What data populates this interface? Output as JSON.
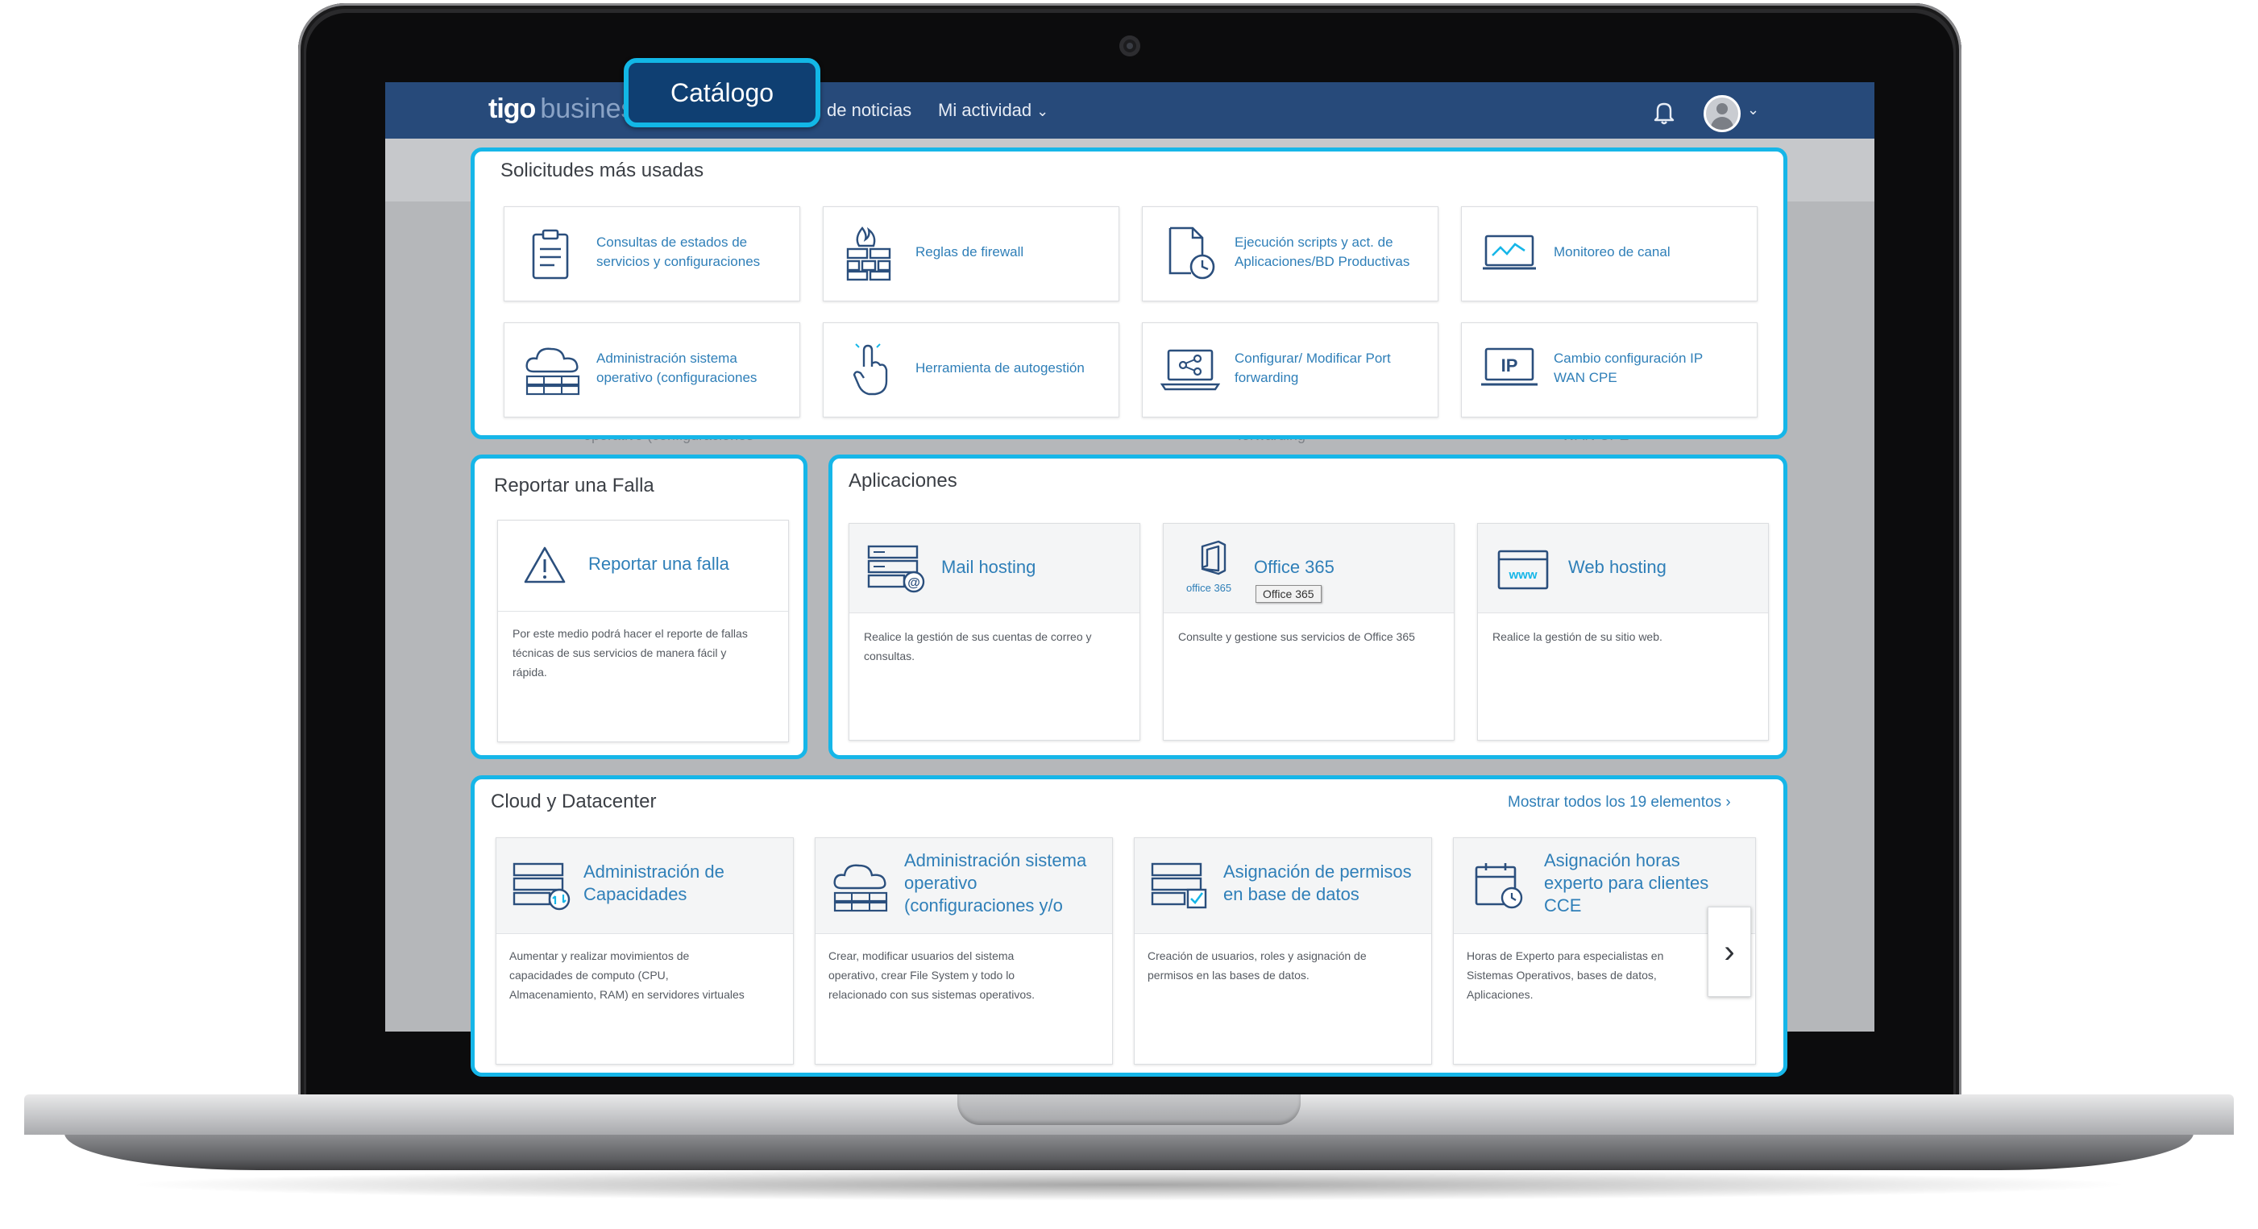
{
  "header": {
    "logo": "tigo",
    "logo_sub": "business",
    "nav": [
      "de noticias",
      "Mi actividad"
    ],
    "chevron": "⌄"
  },
  "callout": {
    "label": "Catálogo"
  },
  "most_used": {
    "title": "Solicitudes más usadas",
    "items": [
      {
        "label": "Consultas de estados de\nservicios y configuraciones",
        "icon": "clipboard-icon"
      },
      {
        "label": "Reglas de firewall",
        "icon": "firewall-icon"
      },
      {
        "label": "Ejecución scripts y act. de\nAplicaciones/BD Productivas",
        "icon": "document-clock-icon"
      },
      {
        "label": "Monitoreo de canal",
        "icon": "monitor-chart-icon"
      },
      {
        "label": "Administración sistema\noperativo (configuraciones",
        "icon": "cloud-servers-icon"
      },
      {
        "label": "Herramienta de autogestión",
        "icon": "hand-pointer-icon"
      },
      {
        "label": "Configurar/ Modificar Port\nforwarding",
        "icon": "laptop-share-icon"
      },
      {
        "label": "Cambio configuración IP\nWAN CPE",
        "icon": "ip-monitor-icon"
      }
    ]
  },
  "ghost_row": [
    "operativo (configuraciones",
    "forwarding",
    "WAN CPE"
  ],
  "report": {
    "title": "Reportar una Falla",
    "card_title": "Reportar una falla",
    "desc": "Por este medio podrá hacer el reporte de fallas\ntécnicas de sus servicios de manera fácil y\nrápida."
  },
  "apps": {
    "title": "Aplicaciones",
    "items": [
      {
        "title": "Mail hosting",
        "desc": "Realice la gestión de sus cuentas de correo y\nconsultas.",
        "icon": "mail-server-icon"
      },
      {
        "title": "Office 365",
        "desc": "Consulte y gestione sus servicios de Office 365",
        "icon": "office365-icon",
        "logo_text": "office 365",
        "tooltip": "Office 365"
      },
      {
        "title": "Web hosting",
        "desc": "Realice la gestión de su sitio web.",
        "icon": "www-icon"
      }
    ]
  },
  "cloud": {
    "title": "Cloud y Datacenter",
    "show_all": "Mostrar todos los 19 elementos ›",
    "items": [
      {
        "title": "Administración de\nCapacidades",
        "desc": "Aumentar y realizar movimientos de\ncapacidades de computo (CPU,\nAlmacenamiento, RAM) en servidores virtuales",
        "icon": "server-sync-icon"
      },
      {
        "title": "Administración sistema\noperativo\n(configuraciones y/o",
        "desc": "Crear, modificar usuarios del sistema\noperativo, crear File System y todo lo\nrelacionado con sus sistemas operativos.",
        "icon": "cloud-servers-icon"
      },
      {
        "title": "Asignación de permisos\nen base de datos",
        "desc": "Creación de usuarios, roles y asignación de\npermisos en las bases de datos.",
        "icon": "server-check-icon"
      },
      {
        "title": "Asignación horas\nexperto para clientes\nCCE",
        "desc": "Horas de Experto para especialistas en\nSistemas Operativos, bases de datos,\nAplicaciones.",
        "icon": "calendar-clock-icon"
      }
    ],
    "next": "›"
  },
  "colors": {
    "accent": "#16b6e8",
    "topbar": "#274a7a",
    "link": "#2f7fb8"
  }
}
